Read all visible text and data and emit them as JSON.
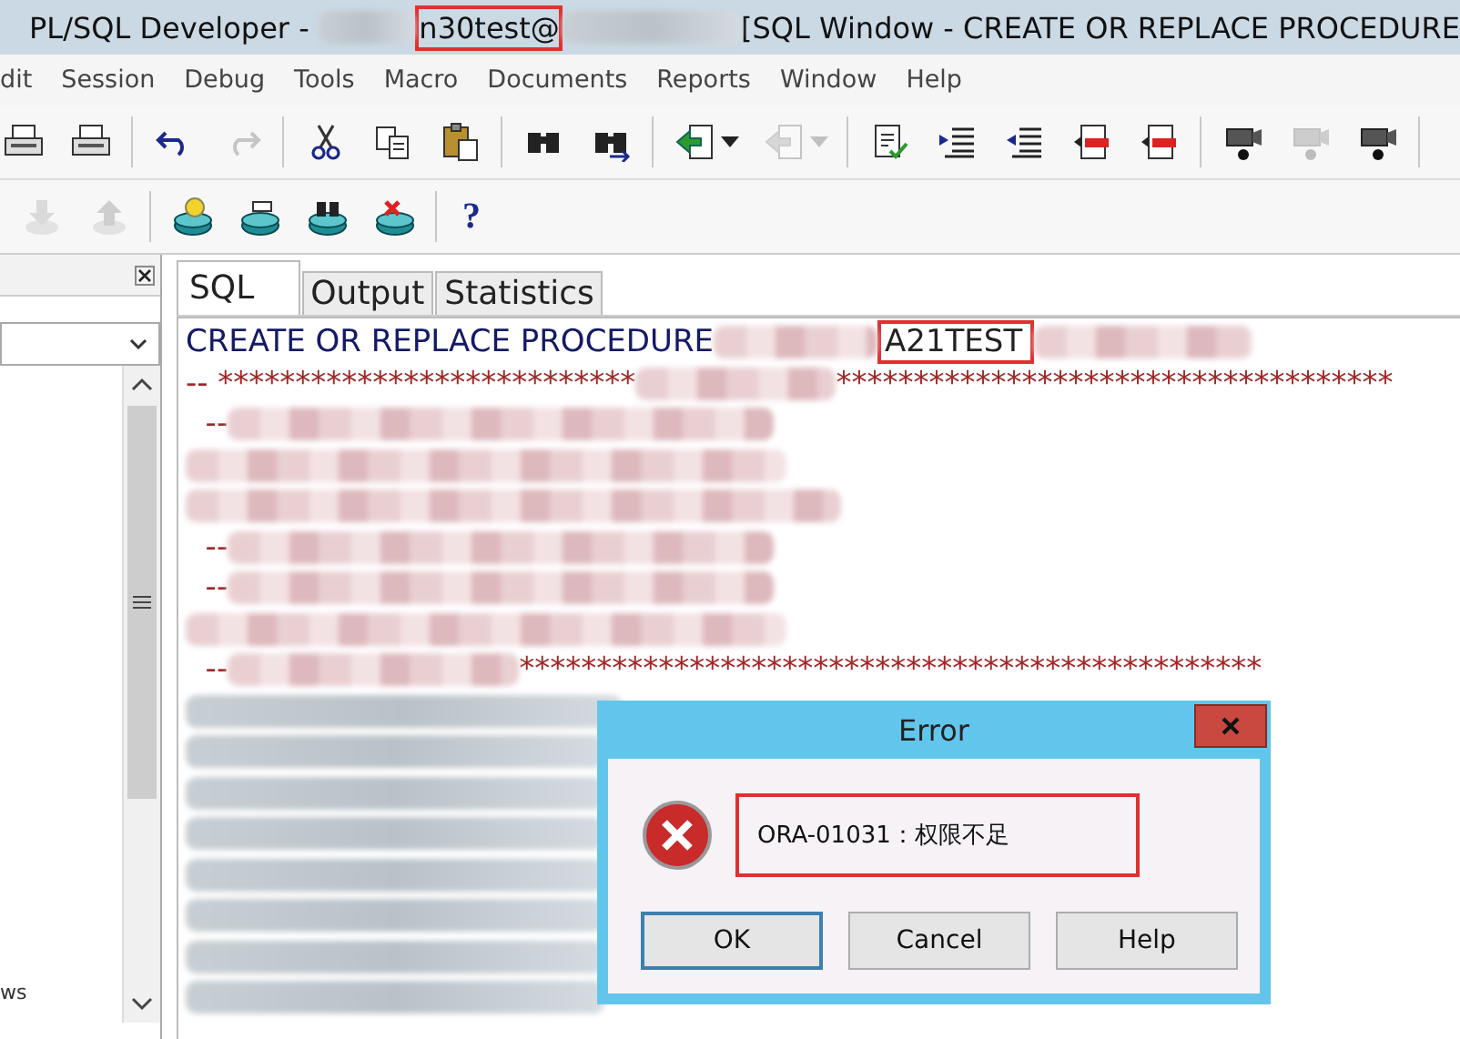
{
  "window": {
    "title_parts": [
      {
        "kind": "text",
        "text": "PL/SQL Developer - "
      },
      {
        "kind": "redacted"
      },
      {
        "kind": "highlighted",
        "text": "n30test@"
      },
      {
        "kind": "redacted"
      },
      {
        "kind": "text",
        "text": "[SQL Window - CREATE OR REPLACE PROCEDURE"
      }
    ]
  },
  "menu": [
    "dit",
    "Session",
    "Debug",
    "Tools",
    "Macro",
    "Documents",
    "Reports",
    "Window",
    "Help"
  ],
  "toolbars": [
    [
      {
        "kind": "printer",
        "disabled": false
      },
      {
        "kind": "printer",
        "disabled": false
      },
      {
        "kind": "separator"
      },
      {
        "kind": "undo",
        "disabled": false
      },
      {
        "kind": "redo",
        "disabled": true
      },
      {
        "kind": "separator"
      },
      {
        "kind": "scissors",
        "disabled": false
      },
      {
        "kind": "copy",
        "disabled": false
      },
      {
        "kind": "paste",
        "disabled": false
      },
      {
        "kind": "separator"
      },
      {
        "kind": "binoculars",
        "disabled": false
      },
      {
        "kind": "binoculars-arrow",
        "disabled": false
      },
      {
        "kind": "separator"
      },
      {
        "kind": "green-arrow-page",
        "disabled": false
      },
      {
        "kind": "caret",
        "disabled": false
      },
      {
        "kind": "green-arrow-page",
        "disabled": true
      },
      {
        "kind": "caret",
        "disabled": true
      },
      {
        "kind": "separator"
      },
      {
        "kind": "page-check",
        "disabled": false
      },
      {
        "kind": "indent",
        "disabled": false
      },
      {
        "kind": "outdent",
        "disabled": false
      },
      {
        "kind": "red-arrow-page",
        "disabled": false
      },
      {
        "kind": "red-arrow-page",
        "disabled": false
      },
      {
        "kind": "separator"
      },
      {
        "kind": "camera",
        "disabled": false
      },
      {
        "kind": "camera",
        "disabled": true
      },
      {
        "kind": "camera",
        "disabled": false
      },
      {
        "kind": "separator"
      }
    ],
    [
      {
        "kind": "down-arrow",
        "disabled": true
      },
      {
        "kind": "up-arrow",
        "disabled": true
      },
      {
        "kind": "separator"
      },
      {
        "kind": "database-bulb",
        "disabled": false
      },
      {
        "kind": "database",
        "disabled": false
      },
      {
        "kind": "database-binoculars",
        "disabled": false
      },
      {
        "kind": "database-cross",
        "disabled": false
      },
      {
        "kind": "separator"
      },
      {
        "kind": "help",
        "disabled": false,
        "label": "?"
      }
    ]
  ],
  "left_panel": {
    "list_text": "ws"
  },
  "tabs": [
    {
      "label": "SQL",
      "selected": true
    },
    {
      "label": "Output",
      "selected": false
    },
    {
      "label": "Statistics",
      "selected": false
    }
  ],
  "editor": {
    "lines": [
      [
        {
          "kind": "keyword",
          "text": "CREATE OR REPLACE PROCEDURE"
        },
        {
          "kind": "redacted"
        },
        {
          "kind": "highlighted",
          "text": "A21TEST"
        },
        {
          "kind": "redacted"
        }
      ],
      [
        {
          "kind": "comment",
          "text": "-- ***************************"
        },
        {
          "kind": "redacted"
        },
        {
          "kind": "comment",
          "text": "************************************"
        }
      ],
      [
        {
          "kind": "comment",
          "text": "  --"
        },
        {
          "kind": "redacted"
        }
      ],
      [
        {
          "kind": "redacted"
        }
      ],
      [
        {
          "kind": "redacted"
        }
      ],
      [
        {
          "kind": "comment",
          "text": "  --"
        },
        {
          "kind": "redacted"
        }
      ],
      [
        {
          "kind": "comment",
          "text": "  --"
        },
        {
          "kind": "redacted"
        }
      ],
      [
        {
          "kind": "redacted"
        }
      ],
      [
        {
          "kind": "comment",
          "text": "  --"
        },
        {
          "kind": "redacted"
        },
        {
          "kind": "comment",
          "text": "************************************************"
        }
      ],
      [
        {
          "kind": "redacted"
        }
      ],
      [
        {
          "kind": "redacted"
        }
      ],
      [
        {
          "kind": "redacted"
        }
      ],
      [
        {
          "kind": "redacted"
        }
      ],
      [
        {
          "kind": "redacted"
        }
      ],
      [
        {
          "kind": "redacted"
        }
      ],
      [
        {
          "kind": "redacted"
        }
      ],
      [
        {
          "kind": "redacted"
        }
      ]
    ]
  },
  "dialog": {
    "title": "Error",
    "message": "ORA-01031：权限不足",
    "message_highlighted": true,
    "buttons": [
      {
        "label": "OK",
        "focused": true
      },
      {
        "label": "Cancel",
        "focused": false
      },
      {
        "label": "Help",
        "focused": false
      }
    ]
  }
}
